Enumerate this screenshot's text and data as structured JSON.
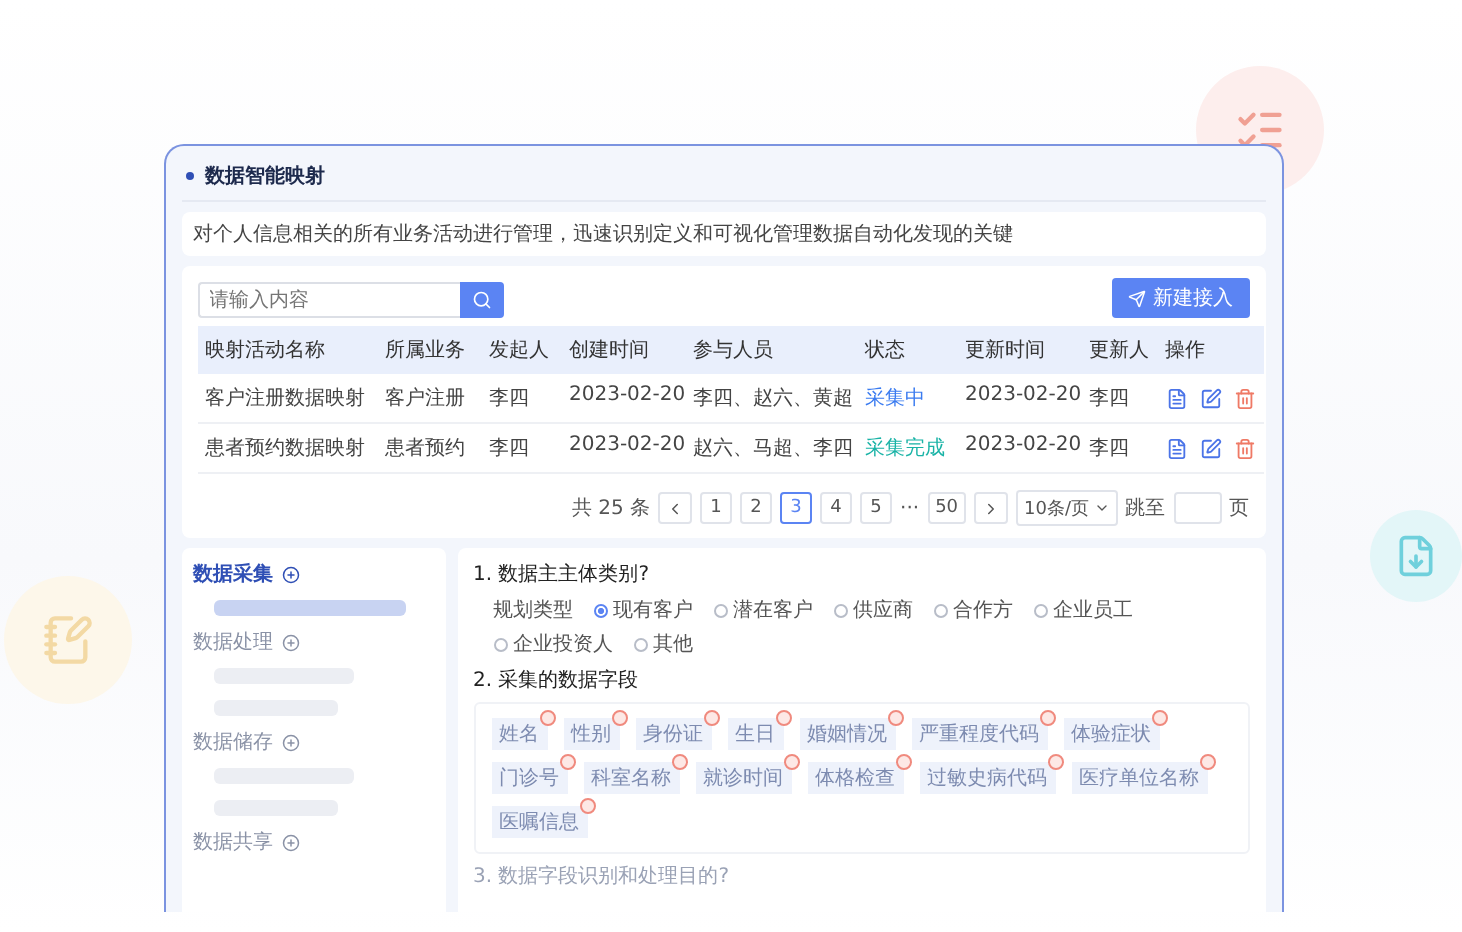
{
  "panel": {
    "title": "数据智能映射",
    "description": "对个人信息相关的所有业务活动进行管理，迅速识别定义和可视化管理数据自动化发现的关键"
  },
  "search": {
    "placeholder": "请输入内容"
  },
  "new_button": "新建接入",
  "table": {
    "columns": [
      "映射活动名称",
      "所属业务",
      "发起人",
      "创建时间",
      "参与人员",
      "状态",
      "更新时间",
      "更新人",
      "操作"
    ],
    "rows": [
      {
        "cells": [
          "客户注册数据映射",
          "客户注册",
          "李四",
          "2023-02-20",
          "李四、赵六、黄超"
        ],
        "status": {
          "text": "采集中",
          "kind": "progress"
        },
        "updated": "2023-02-20",
        "updater": "李四"
      },
      {
        "cells": [
          "患者预约数据映射",
          "患者预约",
          "李四",
          "2023-02-20",
          "赵六、马超、李四"
        ],
        "status": {
          "text": "采集完成",
          "kind": "done"
        },
        "updated": "2023-02-20",
        "updater": "李四"
      }
    ]
  },
  "pagination": {
    "total": "共 25 条",
    "pages": [
      {
        "label": "1",
        "selected": false
      },
      {
        "label": "2",
        "selected": false
      },
      {
        "label": "3",
        "selected": true
      },
      {
        "label": "4",
        "selected": false
      },
      {
        "label": "5",
        "selected": false
      }
    ],
    "ellipsis": "···",
    "last": "50",
    "page_size": "10条/页",
    "jump_label": "跳至",
    "page_suffix": "页"
  },
  "sidebar": {
    "sections": [
      {
        "title": "数据采集",
        "selected": true
      },
      {
        "title": "数据处理",
        "selected": false
      },
      {
        "title": "数据储存",
        "selected": false
      },
      {
        "title": "数据共享",
        "selected": false
      }
    ]
  },
  "questions": [
    {
      "kind": "radio",
      "title": "1. 数据主主体类别?",
      "label": "规划类型",
      "options": [
        {
          "label": "现有客户",
          "selected": true
        },
        {
          "label": "潜在客户",
          "selected": false
        },
        {
          "label": "供应商",
          "selected": false
        },
        {
          "label": "合作方",
          "selected": false
        },
        {
          "label": "企业员工",
          "selected": false
        },
        {
          "label": "企业投资人",
          "selected": false
        },
        {
          "label": "其他",
          "selected": false
        }
      ]
    },
    {
      "kind": "tags",
      "title": "2. 采集的数据字段",
      "tags": [
        "姓名",
        "性别",
        "身份证",
        "生日",
        "婚姻情况",
        "严重程度代码",
        "体验症状",
        "门诊号",
        "科室名称",
        "就诊时间",
        "体格检查",
        "过敏史病代码",
        "医疗单位名称",
        "医嘱信息"
      ]
    },
    {
      "kind": "text",
      "title": "3. 数据字段识别和处理目的?"
    }
  ]
}
